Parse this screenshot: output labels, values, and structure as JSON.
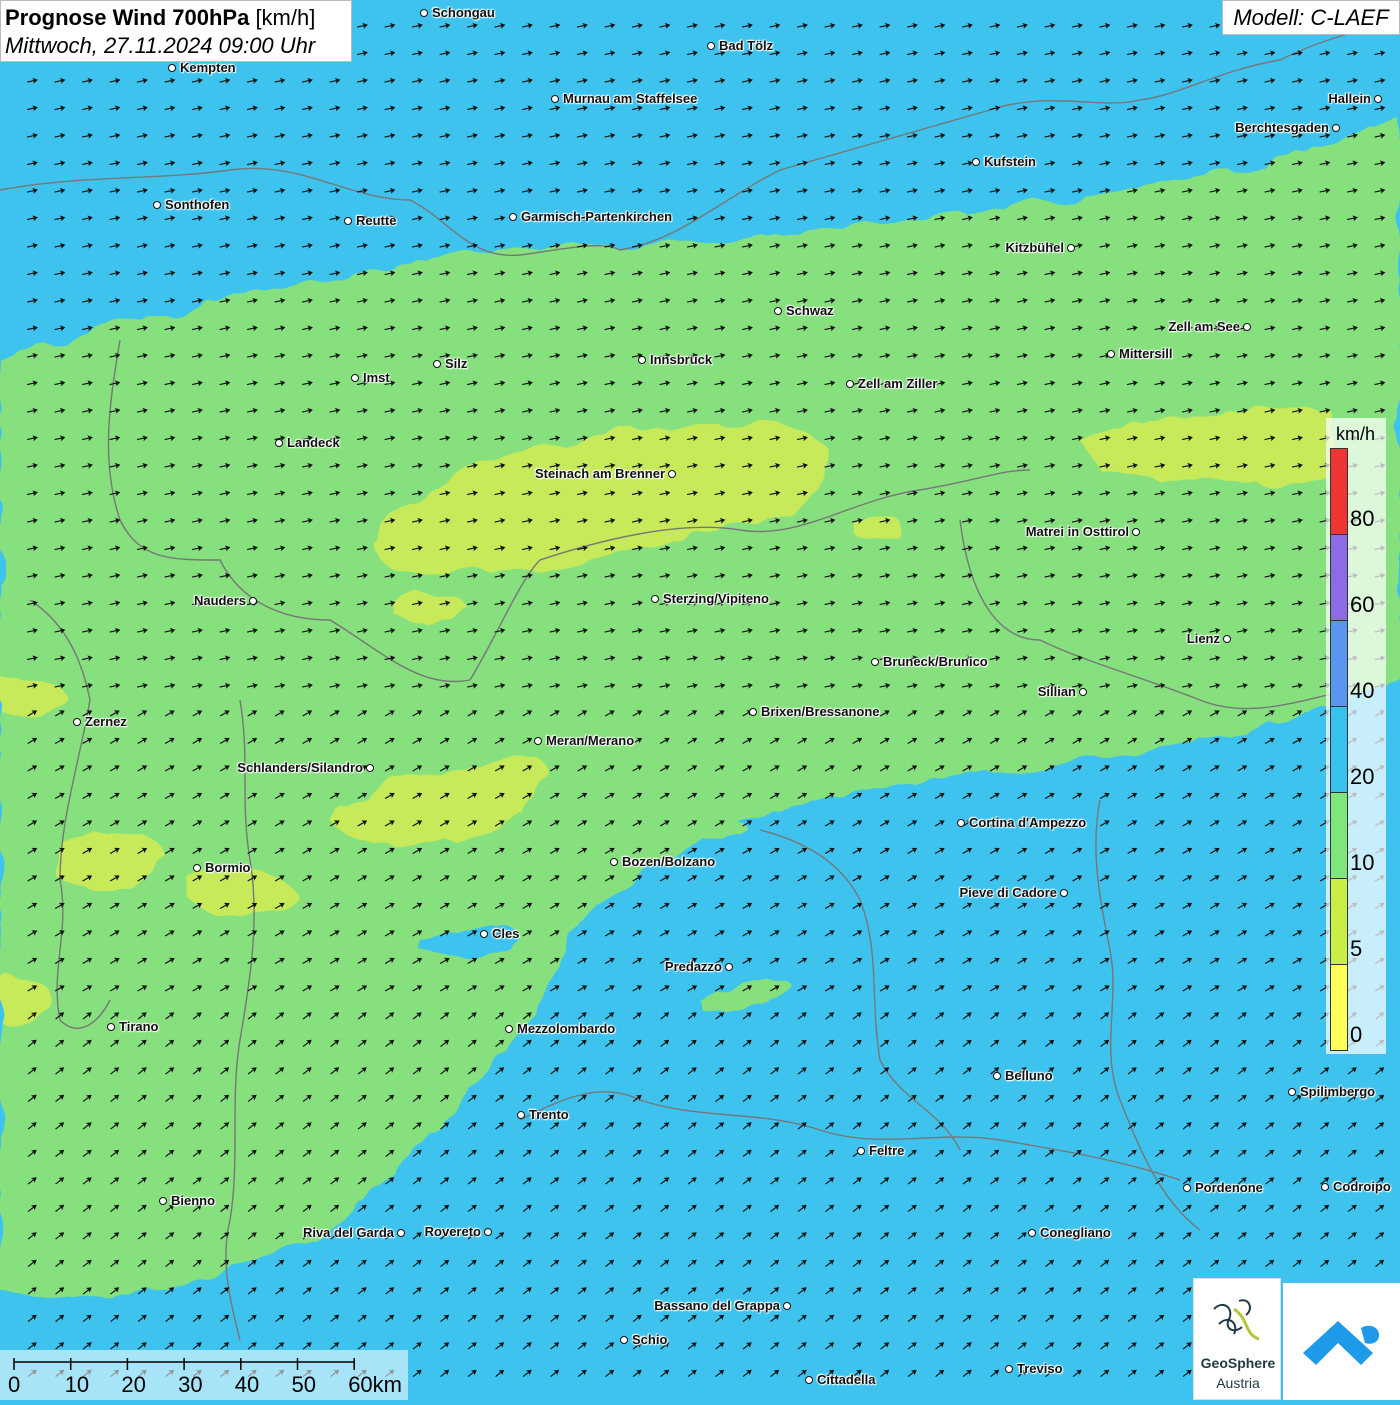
{
  "header": {
    "title_bold": "Prognose Wind 700hPa",
    "title_unit": "[km/h]",
    "subtitle": "Mittwoch, 27.11.2024 09:00 Uhr",
    "model": "Modell: C-LAEF"
  },
  "legend": {
    "unit": "km/h",
    "labels": [
      "0",
      "5",
      "10",
      "20",
      "40",
      "60",
      "80"
    ],
    "colors": [
      "#ffff5a",
      "#c8ef46",
      "#7fe67e",
      "#35c2ee",
      "#5a95ef",
      "#8e6be6",
      "#ef3434"
    ]
  },
  "scale": {
    "labels": [
      "0",
      "10",
      "20",
      "30",
      "40",
      "50",
      "60km"
    ]
  },
  "logos": {
    "geosphere_line1": "GeoSphere",
    "geosphere_line2": "Austria"
  },
  "cities": [
    {
      "name": "Schongau",
      "side": "right"
    },
    {
      "name": "Bad Tölz",
      "side": "right"
    },
    {
      "name": "Kempten",
      "side": "right"
    },
    {
      "name": "Hallein",
      "side": "left"
    },
    {
      "name": "Murnau am Staffelsee",
      "side": "right"
    },
    {
      "name": "Berchtesgaden",
      "side": "left"
    },
    {
      "name": "Kufstein",
      "side": "right"
    },
    {
      "name": "Sonthofen",
      "side": "right"
    },
    {
      "name": "Reutte",
      "side": "right"
    },
    {
      "name": "Garmisch-Partenkirchen",
      "side": "right"
    },
    {
      "name": "Kitzbühel",
      "side": "left"
    },
    {
      "name": "Schwaz",
      "side": "right"
    },
    {
      "name": "Zell am See",
      "side": "left"
    },
    {
      "name": "Innsbruck",
      "side": "right"
    },
    {
      "name": "Silz",
      "side": "right"
    },
    {
      "name": "Mittersill",
      "side": "right"
    },
    {
      "name": "Imst",
      "side": "right"
    },
    {
      "name": "Zell am Ziller",
      "side": "right"
    },
    {
      "name": "Landeck",
      "side": "right"
    },
    {
      "name": "Steinach am Brenner",
      "side": "left"
    },
    {
      "name": "Matrei in Osttirol",
      "side": "left"
    },
    {
      "name": "Nauders",
      "side": "left"
    },
    {
      "name": "Sterzing/Vipiteno",
      "side": "right"
    },
    {
      "name": "Lienz",
      "side": "left"
    },
    {
      "name": "Bruneck/Brunico",
      "side": "right"
    },
    {
      "name": "Sillian",
      "side": "left"
    },
    {
      "name": "Zernez",
      "side": "right"
    },
    {
      "name": "Brixen/Bressanone",
      "side": "right"
    },
    {
      "name": "Meran/Merano",
      "side": "right"
    },
    {
      "name": "Schlanders/Silandro",
      "side": "left"
    },
    {
      "name": "Cortina d'Ampezzo",
      "side": "right"
    },
    {
      "name": "Bozen/Bolzano",
      "side": "right"
    },
    {
      "name": "Bormio",
      "side": "right"
    },
    {
      "name": "Pieve di Cadore",
      "side": "left"
    },
    {
      "name": "Cles",
      "side": "right"
    },
    {
      "name": "Predazzo",
      "side": "left"
    },
    {
      "name": "Tirano",
      "side": "right"
    },
    {
      "name": "Mezzolombardo",
      "side": "right"
    },
    {
      "name": "Belluno",
      "side": "right"
    },
    {
      "name": "Spilimbergo",
      "side": "right"
    },
    {
      "name": "Trento",
      "side": "right"
    },
    {
      "name": "Feltre",
      "side": "right"
    },
    {
      "name": "Bienno",
      "side": "right"
    },
    {
      "name": "Pordenone",
      "side": "right"
    },
    {
      "name": "Codroipo",
      "side": "right"
    },
    {
      "name": "Riva del Garda",
      "side": "left"
    },
    {
      "name": "Rovereto",
      "side": "left"
    },
    {
      "name": "Conegliano",
      "side": "right"
    },
    {
      "name": "Bassano del Grappa",
      "side": "left"
    },
    {
      "name": "Schio",
      "side": "right"
    },
    {
      "name": "Treviso",
      "side": "right"
    },
    {
      "name": "Cittadella",
      "side": "right"
    }
  ]
}
